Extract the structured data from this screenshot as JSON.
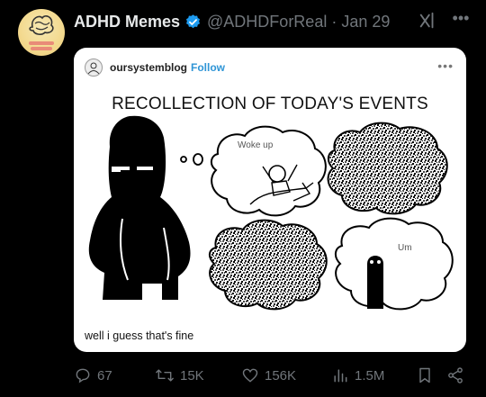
{
  "tweet": {
    "display_name": "ADHD Memes",
    "handle": "@ADHDForReal",
    "separator": "·",
    "date": "Jan 29"
  },
  "embed": {
    "blog_name": "oursystemblog",
    "follow_label": "Follow",
    "more_label": "•••",
    "meme_title": "RECOLLECTION OF TODAY'S EVENTS",
    "bubble_text_1": "Woke up",
    "bubble_text_2": "Um",
    "caption": "well i guess that's fine"
  },
  "actions": {
    "replies": "67",
    "reposts": "15K",
    "likes": "156K",
    "views": "1.5M"
  },
  "colors": {
    "background": "#000000",
    "verified_blue": "#1d9bf0",
    "muted_gray": "#71767b",
    "follow_blue": "#2f95d6"
  },
  "icons": [
    "verified-badge-icon",
    "grok-icon",
    "more-icon",
    "reply-icon",
    "repost-icon",
    "like-icon",
    "views-icon",
    "bookmark-icon",
    "share-icon"
  ]
}
